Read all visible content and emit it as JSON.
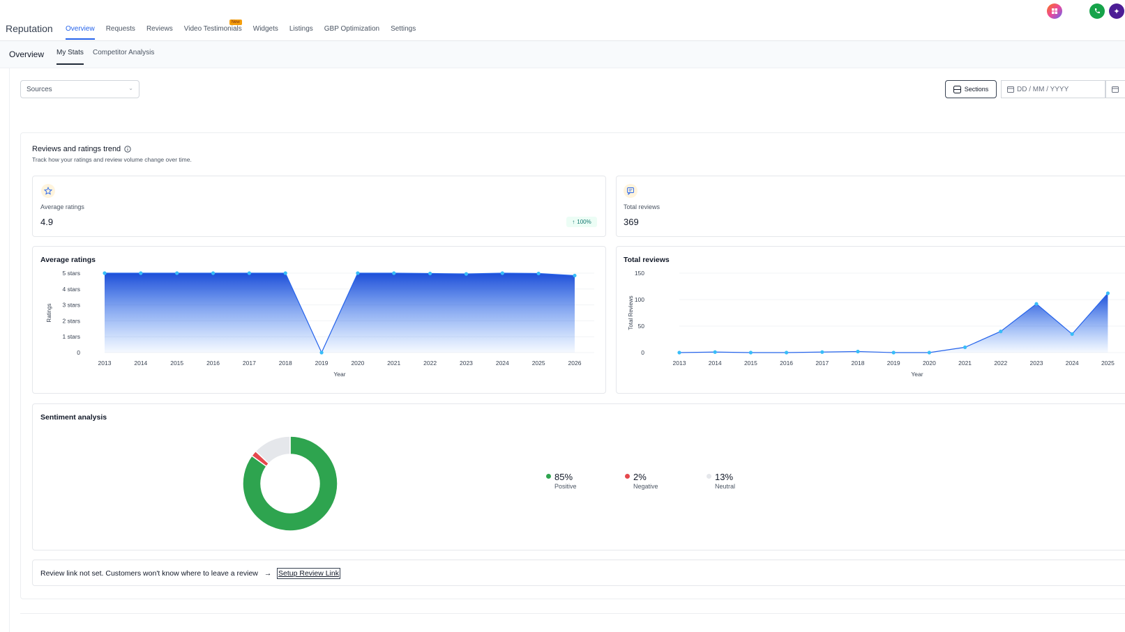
{
  "app": {
    "brand": "Reputation",
    "nav": [
      {
        "label": "Overview",
        "active": true
      },
      {
        "label": "Requests"
      },
      {
        "label": "Reviews"
      },
      {
        "label": "Video Testimonials",
        "badge": "New"
      },
      {
        "label": "Widgets"
      },
      {
        "label": "Listings"
      },
      {
        "label": "GBP Optimization"
      },
      {
        "label": "Settings"
      }
    ]
  },
  "subnav": {
    "title": "Overview",
    "tabs": [
      {
        "label": "My Stats",
        "active": true
      },
      {
        "label": "Competitor Analysis"
      }
    ]
  },
  "filters": {
    "sources_placeholder": "Sources",
    "sections_label": "Sections",
    "date_placeholder": "DD / MM / YYYY"
  },
  "trend_section": {
    "title": "Reviews and ratings trend",
    "subtitle": "Track how your ratings and review volume change over time."
  },
  "stats": {
    "avg_label": "Average ratings",
    "avg_value": "4.9",
    "avg_change": "100%",
    "total_label": "Total reviews",
    "total_value": "369"
  },
  "colors": {
    "accent": "#2563eb",
    "positive": "#2ea44f",
    "negative": "#e5484d",
    "neutral": "#e5e7eb"
  },
  "chart_data": [
    {
      "type": "area",
      "title": "Average ratings",
      "xlabel": "Year",
      "ylabel": "Ratings",
      "ytick_labels": [
        "0",
        "1 stars",
        "2 stars",
        "3 stars",
        "4 stars",
        "5 stars"
      ],
      "ylim": [
        0,
        5
      ],
      "x": [
        "2013",
        "2014",
        "2015",
        "2016",
        "2017",
        "2018",
        "2019",
        "2020",
        "2021",
        "2022",
        "2023",
        "2024",
        "2025",
        "2026"
      ],
      "values": [
        5,
        5,
        5,
        5,
        5,
        5,
        0,
        5,
        5,
        4.98,
        4.95,
        5,
        4.98,
        4.85
      ]
    },
    {
      "type": "area",
      "title": "Total reviews",
      "xlabel": "Year",
      "ylabel": "Total Reviews",
      "ytick_labels": [
        "0",
        "50",
        "100",
        "150"
      ],
      "ylim": [
        0,
        150
      ],
      "x": [
        "2013",
        "2014",
        "2015",
        "2016",
        "2017",
        "2018",
        "2019",
        "2020",
        "2021",
        "2022",
        "2023",
        "2024",
        "2025"
      ],
      "values": [
        0,
        1,
        0,
        0,
        1,
        2,
        0,
        0,
        10,
        40,
        92,
        35,
        112
      ]
    },
    {
      "type": "pie",
      "title": "Sentiment analysis",
      "categories": [
        "Positive",
        "Negative",
        "Neutral"
      ],
      "values": [
        85,
        2,
        13
      ],
      "labels": [
        "85%",
        "2%",
        "13%"
      ]
    }
  ],
  "review_notice": {
    "text": "Review link not set. Customers won't know where to leave a review",
    "arrow": "→",
    "link": "Setup Review Link"
  }
}
